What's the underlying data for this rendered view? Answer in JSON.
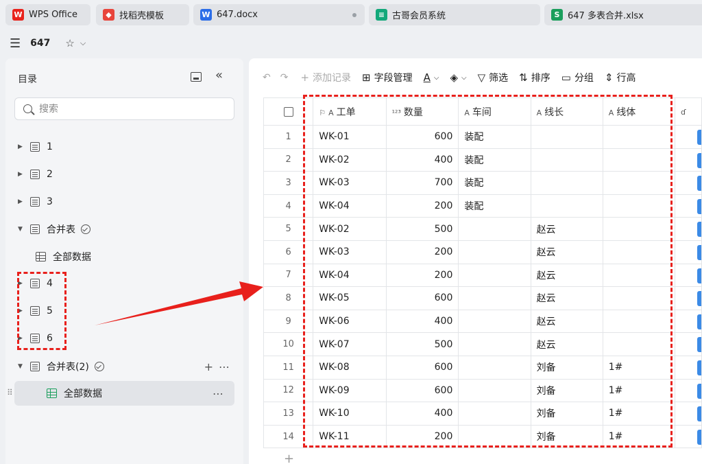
{
  "tabs": [
    {
      "label": "WPS Office",
      "icon": "wps-logo-icon",
      "color": "#e8231c"
    },
    {
      "label": "找稻壳模板",
      "icon": "docer-icon",
      "color": "#e8453c"
    },
    {
      "label": "647.docx",
      "icon": "word-doc-icon",
      "color": "#2b6de8"
    },
    {
      "label": "古哥会员系统",
      "icon": "multi-dim-table-icon",
      "color": "#12a87a"
    },
    {
      "label": "647 多表合并.xlsx",
      "icon": "spreadsheet-icon",
      "color": "#1a9e5c"
    }
  ],
  "title_row": {
    "doc_name": "647"
  },
  "sidebar": {
    "header": "目录",
    "search_placeholder": "搜索",
    "items": [
      {
        "label": "1"
      },
      {
        "label": "2"
      },
      {
        "label": "3"
      },
      {
        "label": "合并表"
      },
      {
        "label": "全部数据"
      },
      {
        "label": "4"
      },
      {
        "label": "5"
      },
      {
        "label": "6"
      },
      {
        "label": "合并表(2)"
      },
      {
        "label": "全部数据"
      }
    ]
  },
  "toolbar": {
    "add_record": "添加记录",
    "field_manage": "字段管理",
    "filter": "筛选",
    "sort": "排序",
    "group": "分组",
    "row_height": "行高"
  },
  "table": {
    "columns": [
      "工单",
      "数量",
      "车间",
      "线长",
      "线体"
    ],
    "rows": [
      {
        "n": "1",
        "wo": "WK-01",
        "qty": "600",
        "ws": "装配",
        "lead": "",
        "line": ""
      },
      {
        "n": "2",
        "wo": "WK-02",
        "qty": "400",
        "ws": "装配",
        "lead": "",
        "line": ""
      },
      {
        "n": "3",
        "wo": "WK-03",
        "qty": "700",
        "ws": "装配",
        "lead": "",
        "line": ""
      },
      {
        "n": "4",
        "wo": "WK-04",
        "qty": "200",
        "ws": "装配",
        "lead": "",
        "line": ""
      },
      {
        "n": "5",
        "wo": "WK-02",
        "qty": "500",
        "ws": "",
        "lead": "赵云",
        "line": ""
      },
      {
        "n": "6",
        "wo": "WK-03",
        "qty": "200",
        "ws": "",
        "lead": "赵云",
        "line": ""
      },
      {
        "n": "7",
        "wo": "WK-04",
        "qty": "200",
        "ws": "",
        "lead": "赵云",
        "line": ""
      },
      {
        "n": "8",
        "wo": "WK-05",
        "qty": "600",
        "ws": "",
        "lead": "赵云",
        "line": ""
      },
      {
        "n": "9",
        "wo": "WK-06",
        "qty": "400",
        "ws": "",
        "lead": "赵云",
        "line": ""
      },
      {
        "n": "10",
        "wo": "WK-07",
        "qty": "500",
        "ws": "",
        "lead": "赵云",
        "line": ""
      },
      {
        "n": "11",
        "wo": "WK-08",
        "qty": "600",
        "ws": "",
        "lead": "刘备",
        "line": "1#"
      },
      {
        "n": "12",
        "wo": "WK-09",
        "qty": "600",
        "ws": "",
        "lead": "刘备",
        "line": "1#"
      },
      {
        "n": "13",
        "wo": "WK-10",
        "qty": "400",
        "ws": "",
        "lead": "刘备",
        "line": "1#"
      },
      {
        "n": "14",
        "wo": "WK-11",
        "qty": "200",
        "ws": "",
        "lead": "刘备",
        "line": "1#"
      }
    ]
  },
  "colors": {
    "annotation": "#e8201c",
    "selected_green": "#1a9e5c",
    "accent_blue": "#3b8ae6"
  }
}
